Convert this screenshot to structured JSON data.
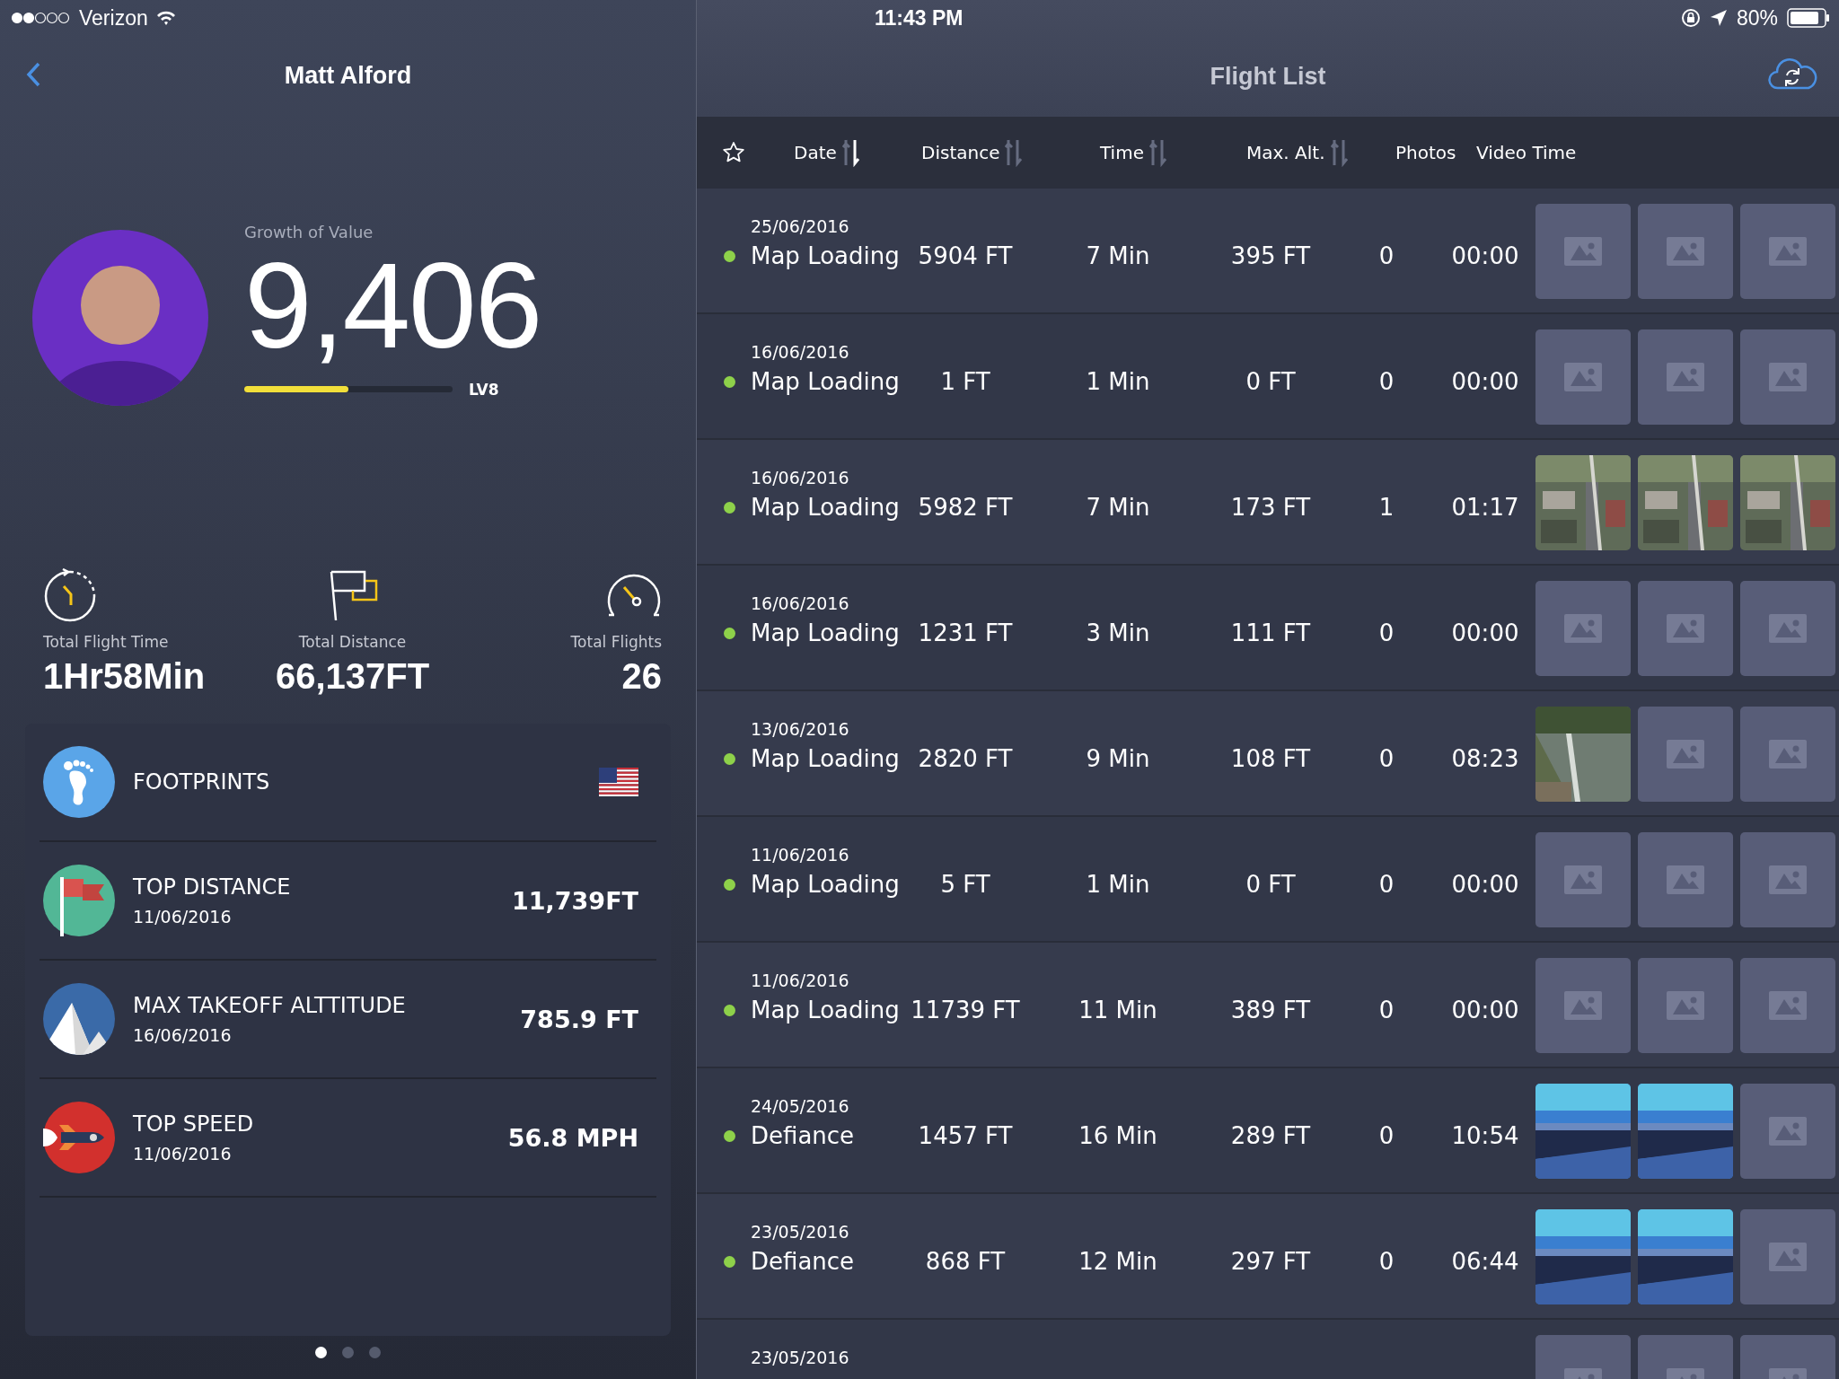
{
  "status_bar": {
    "carrier": "Verizon",
    "time": "11:43 PM",
    "battery": "80%"
  },
  "profile": {
    "title": "Matt Alford",
    "growth_label": "Growth of Value",
    "growth_value": "9,406",
    "progress": {
      "level": 0.5
    },
    "level_label": "LV8"
  },
  "stats": [
    {
      "kind": "time",
      "label": "Total Flight Time",
      "value": "1Hr58Min"
    },
    {
      "kind": "distance",
      "label": "Total Distance",
      "value": "66,137FT"
    },
    {
      "kind": "flights",
      "label": "Total Flights",
      "value": "26"
    }
  ],
  "records": [
    {
      "kind": "footprints",
      "title": "FOOTPRINTS",
      "flag": true
    },
    {
      "kind": "distance",
      "title": "TOP DISTANCE",
      "date": "11/06/2016",
      "value": "11,739FT"
    },
    {
      "kind": "altitude",
      "title": "MAX TAKEOFF ALTTITUDE",
      "date": "16/06/2016",
      "value": "785.9 FT"
    },
    {
      "kind": "speed",
      "title": "TOP SPEED",
      "date": "11/06/2016",
      "value": "56.8 MPH"
    }
  ],
  "pager": [
    {
      "selected": true
    },
    {
      "selected": false
    },
    {
      "selected": false
    }
  ],
  "flight_list": {
    "title": "Flight List",
    "columns": [
      {
        "label": "Date",
        "sortable": true,
        "selected": true
      },
      {
        "label": "Distance",
        "sortable": true,
        "selected": false
      },
      {
        "label": "Time",
        "sortable": true,
        "selected": false
      },
      {
        "label": "Max. Alt.",
        "sortable": true,
        "selected": false
      },
      {
        "label": "Photos",
        "sortable": false
      },
      {
        "label": "Video Time",
        "sortable": false
      }
    ],
    "rows": [
      {
        "date": "25/06/2016",
        "name": "Map Loading",
        "distance": "5904 FT",
        "time": "7 Min",
        "max_alt": "395 FT",
        "photos": "0",
        "video_time": "00:00",
        "thumbnails": [
          {
            "kind": "placeholder"
          },
          {
            "kind": "placeholder"
          },
          {
            "kind": "placeholder"
          }
        ]
      },
      {
        "date": "16/06/2016",
        "name": "Map Loading",
        "distance": "1 FT",
        "time": "1 Min",
        "max_alt": "0 FT",
        "photos": "0",
        "video_time": "00:00",
        "thumbnails": [
          {
            "kind": "placeholder"
          },
          {
            "kind": "placeholder"
          },
          {
            "kind": "placeholder"
          }
        ]
      },
      {
        "date": "16/06/2016",
        "name": "Map Loading",
        "distance": "5982 FT",
        "time": "7 Min",
        "max_alt": "173 FT",
        "photos": "1",
        "video_time": "01:17",
        "thumbnails": [
          {
            "kind": "picture"
          },
          {
            "kind": "picture"
          },
          {
            "kind": "picture"
          }
        ]
      },
      {
        "date": "16/06/2016",
        "name": "Map Loading",
        "distance": "1231 FT",
        "time": "3 Min",
        "max_alt": "111 FT",
        "photos": "0",
        "video_time": "00:00",
        "thumbnails": [
          {
            "kind": "placeholder"
          },
          {
            "kind": "placeholder"
          },
          {
            "kind": "placeholder"
          }
        ]
      },
      {
        "date": "13/06/2016",
        "name": "Map Loading",
        "distance": "2820 FT",
        "time": "9 Min",
        "max_alt": "108 FT",
        "photos": "0",
        "video_time": "08:23",
        "thumbnails": [
          {
            "kind": "picture"
          },
          {
            "kind": "placeholder"
          },
          {
            "kind": "placeholder"
          }
        ]
      },
      {
        "date": "11/06/2016",
        "name": "Map Loading",
        "distance": "5 FT",
        "time": "1 Min",
        "max_alt": "0 FT",
        "photos": "0",
        "video_time": "00:00",
        "thumbnails": [
          {
            "kind": "placeholder"
          },
          {
            "kind": "placeholder"
          },
          {
            "kind": "placeholder"
          }
        ]
      },
      {
        "date": "11/06/2016",
        "name": "Map Loading",
        "distance": "11739 FT",
        "time": "11 Min",
        "max_alt": "389 FT",
        "photos": "0",
        "video_time": "00:00",
        "thumbnails": [
          {
            "kind": "placeholder"
          },
          {
            "kind": "placeholder"
          },
          {
            "kind": "placeholder"
          }
        ]
      },
      {
        "date": "24/05/2016",
        "name": "Defiance",
        "distance": "1457 FT",
        "time": "16 Min",
        "max_alt": "289 FT",
        "photos": "0",
        "video_time": "10:54",
        "thumbnails": [
          {
            "kind": "picture"
          },
          {
            "kind": "picture"
          },
          {
            "kind": "placeholder"
          }
        ]
      },
      {
        "date": "23/05/2016",
        "name": "Defiance",
        "distance": "868 FT",
        "time": "12 Min",
        "max_alt": "297 FT",
        "photos": "0",
        "video_time": "06:44",
        "thumbnails": [
          {
            "kind": "picture"
          },
          {
            "kind": "picture"
          },
          {
            "kind": "placeholder"
          }
        ]
      },
      {
        "date": "23/05/2016",
        "thumbnails": [
          {
            "kind": "placeholder"
          },
          {
            "kind": "placeholder"
          },
          {
            "kind": "placeholder"
          }
        ]
      }
    ]
  }
}
